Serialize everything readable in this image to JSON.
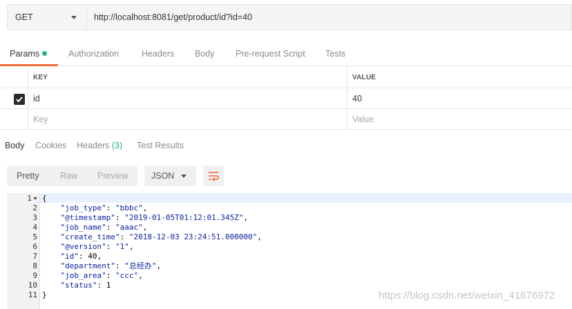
{
  "request": {
    "method": "GET",
    "url": "http://localhost:8081/get/product/id?id=40"
  },
  "request_tabs": [
    {
      "label": "Params",
      "active": true
    },
    {
      "label": "Authorization"
    },
    {
      "label": "Headers"
    },
    {
      "label": "Body"
    },
    {
      "label": "Pre-request Script"
    },
    {
      "label": "Tests"
    }
  ],
  "params": {
    "headers": {
      "key": "KEY",
      "value": "VALUE"
    },
    "rows": [
      {
        "checked": true,
        "key": "id",
        "value": "40"
      }
    ],
    "placeholder": {
      "key": "Key",
      "value": "Value"
    }
  },
  "response_tabs": [
    {
      "label": "Body",
      "active": true
    },
    {
      "label": "Cookies"
    },
    {
      "label": "Headers",
      "count": "(3)"
    },
    {
      "label": "Test Results"
    }
  ],
  "body_toolbar": {
    "views": [
      "Pretty",
      "Raw",
      "Preview"
    ],
    "active_view": "Pretty",
    "format": "JSON"
  },
  "response_lines": [
    {
      "n": "1",
      "text": "{"
    },
    {
      "n": "2",
      "text": "    \"job_type\": \"bbbc\","
    },
    {
      "n": "3",
      "text": "    \"@timestamp\": \"2019-01-05T01:12:01.345Z\","
    },
    {
      "n": "4",
      "text": "    \"job_name\": \"aaac\","
    },
    {
      "n": "5",
      "text": "    \"create_time\": \"2018-12-03 23:24:51.000000\","
    },
    {
      "n": "6",
      "text": "    \"@version\": \"1\","
    },
    {
      "n": "7",
      "text": "    \"id\": 40,"
    },
    {
      "n": "8",
      "text": "    \"department\": \"总经办\","
    },
    {
      "n": "9",
      "text": "    \"job_area\": \"ccc\","
    },
    {
      "n": "10",
      "text": "    \"status\": 1"
    },
    {
      "n": "11",
      "text": "}"
    }
  ],
  "watermark": "https://blog.csdn.net/weixin_41676972",
  "colors": {
    "accent": "#f26b3a",
    "success": "#26b47f",
    "code_key": "#0a22a0"
  }
}
